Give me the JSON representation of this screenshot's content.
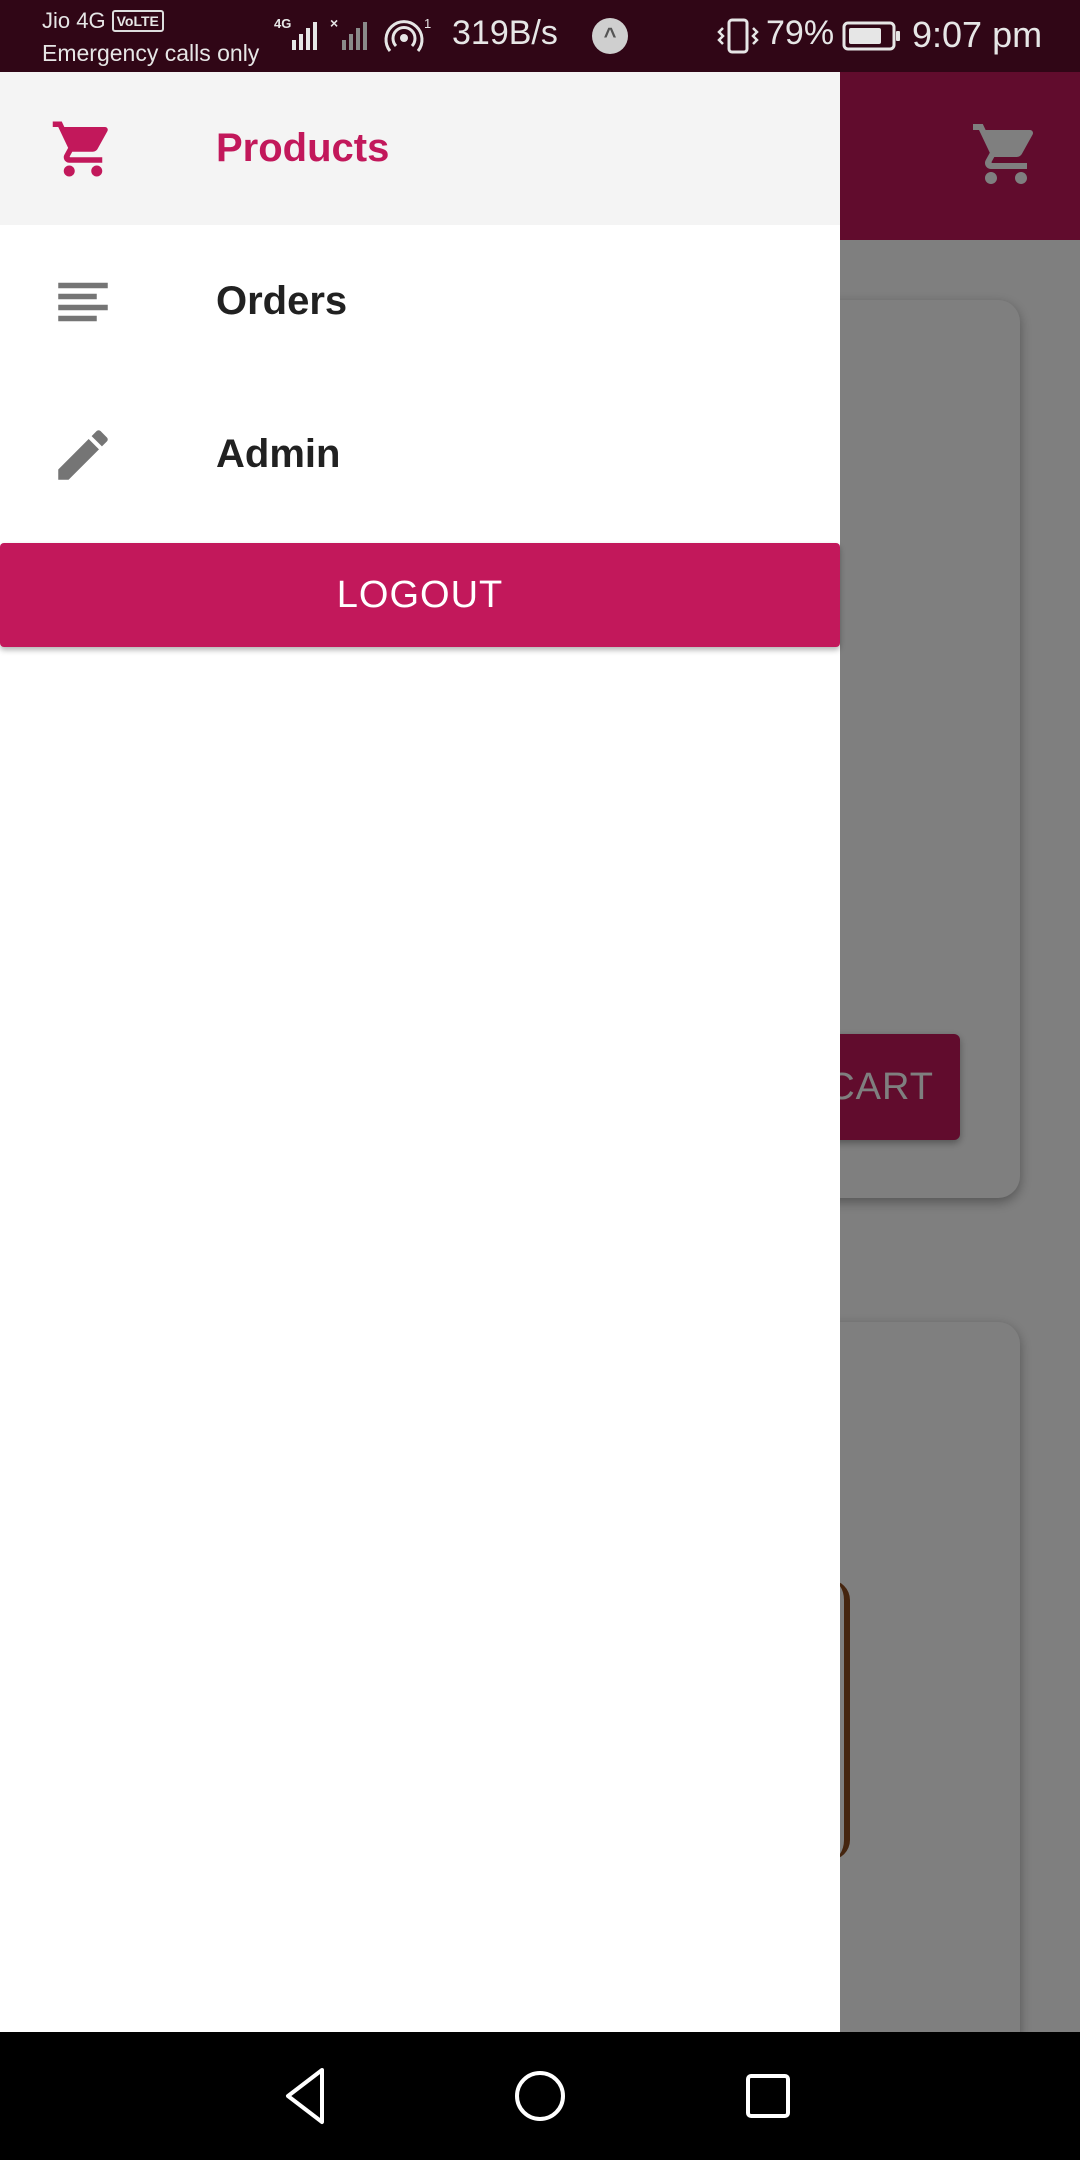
{
  "status_bar": {
    "carrier": "Jio 4G",
    "volte_badge": "VoLTE",
    "emergency": "Emergency calls only",
    "network_speed": "319B/s",
    "battery_percent": "79%",
    "time": "9:07 pm",
    "icons": [
      "signal-4g-icon",
      "signal-none-icon",
      "hotspot-icon",
      "upload-indicator-icon",
      "vibrate-icon",
      "battery-icon"
    ]
  },
  "drawer": {
    "items": [
      {
        "label": "Products",
        "icon": "cart-icon",
        "active": true
      },
      {
        "label": "Orders",
        "icon": "list-icon",
        "active": false
      },
      {
        "label": "Admin",
        "icon": "edit-icon",
        "active": false
      }
    ],
    "logout_label": "LOGOUT"
  },
  "background_app": {
    "add_to_cart_visible_text": "CART",
    "appbar_icon": "cart-icon"
  },
  "nav_bar": {
    "icons": [
      "back-icon",
      "home-icon",
      "recents-icon"
    ]
  },
  "colors": {
    "accent": "#c2185b",
    "drawer_active_bg": "#f4f4f4",
    "icon_grey": "#757575",
    "text_dark": "#212121"
  }
}
